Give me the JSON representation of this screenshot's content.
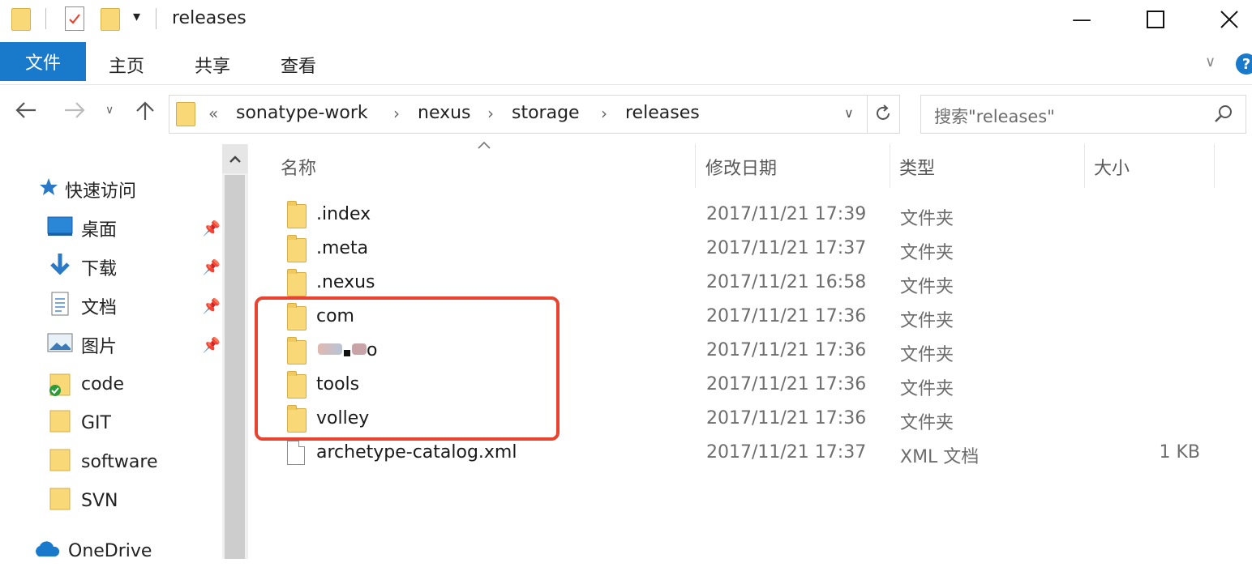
{
  "window": {
    "title": "releases",
    "minimize_glyph": "—",
    "maximize_glyph": "☐",
    "close_glyph": "✕"
  },
  "ribbon": {
    "tabs": [
      "文件",
      "主页",
      "共享",
      "查看"
    ],
    "expand_glyph": "∨",
    "help_glyph": "?"
  },
  "address": {
    "overflow": "«",
    "crumbs": [
      "sonatype-work",
      "nexus",
      "storage",
      "releases"
    ],
    "separator": "›",
    "search_placeholder": "搜索\"releases\""
  },
  "nav": {
    "quick_access": "快速访问",
    "items": [
      {
        "label": "桌面",
        "icon": "desktop-icon",
        "pinned": true
      },
      {
        "label": "下载",
        "icon": "download-icon",
        "pinned": true
      },
      {
        "label": "文档",
        "icon": "document-icon",
        "pinned": true
      },
      {
        "label": "图片",
        "icon": "pictures-icon",
        "pinned": true
      },
      {
        "label": "code",
        "icon": "folder-sync-icon",
        "pinned": false
      },
      {
        "label": "GIT",
        "icon": "folder-icon",
        "pinned": false
      },
      {
        "label": "software",
        "icon": "folder-icon",
        "pinned": false
      },
      {
        "label": "SVN",
        "icon": "folder-icon",
        "pinned": false
      }
    ],
    "onedrive": "OneDrive"
  },
  "columns": {
    "name": "名称",
    "modified": "修改日期",
    "type": "类型",
    "size": "大小"
  },
  "files": [
    {
      "name": ".index",
      "modified": "2017/11/21 17:39",
      "type": "文件夹",
      "size": "",
      "kind": "folder"
    },
    {
      "name": ".meta",
      "modified": "2017/11/21 17:37",
      "type": "文件夹",
      "size": "",
      "kind": "folder"
    },
    {
      "name": ".nexus",
      "modified": "2017/11/21 16:58",
      "type": "文件夹",
      "size": "",
      "kind": "folder"
    },
    {
      "name": "com",
      "modified": "2017/11/21 17:36",
      "type": "文件夹",
      "size": "",
      "kind": "folder"
    },
    {
      "name": "o",
      "modified": "2017/11/21 17:36",
      "type": "文件夹",
      "size": "",
      "kind": "folder-redacted"
    },
    {
      "name": "tools",
      "modified": "2017/11/21 17:36",
      "type": "文件夹",
      "size": "",
      "kind": "folder"
    },
    {
      "name": "volley",
      "modified": "2017/11/21 17:36",
      "type": "文件夹",
      "size": "",
      "kind": "folder"
    },
    {
      "name": "archetype-catalog.xml",
      "modified": "2017/11/21 17:37",
      "type": "XML 文档",
      "size": "1 KB",
      "kind": "file"
    }
  ],
  "colors": {
    "accent": "#1979ca",
    "highlight": "#e8432f",
    "folder": "#f8d877"
  }
}
